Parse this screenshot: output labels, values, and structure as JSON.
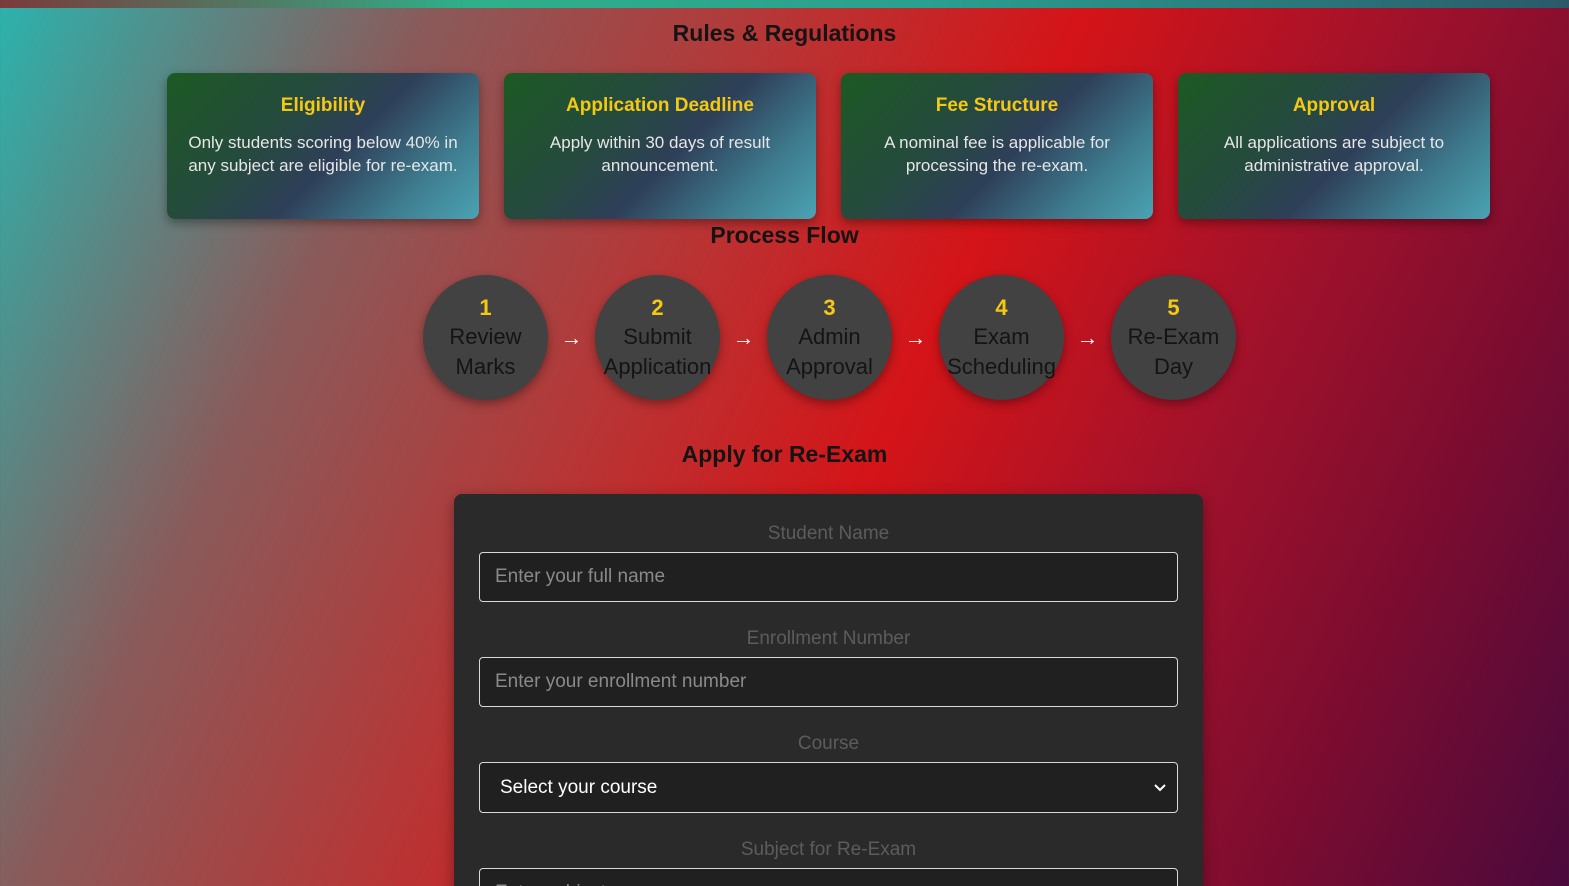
{
  "rules": {
    "title": "Rules & Regulations",
    "cards": [
      {
        "title": "Eligibility",
        "text": "Only students scoring below 40% in any subject are eligible for re-exam."
      },
      {
        "title": "Application Deadline",
        "text": "Apply within 30 days of result announcement."
      },
      {
        "title": "Fee Structure",
        "text": "A nominal fee is applicable for processing the re-exam."
      },
      {
        "title": "Approval",
        "text": "All applications are subject to administrative approval."
      }
    ]
  },
  "process": {
    "title": "Process Flow",
    "arrow": "→",
    "steps": [
      {
        "num": "1",
        "line1": "Review",
        "line2": "Marks"
      },
      {
        "num": "2",
        "line1": "Submit",
        "line2": "Application"
      },
      {
        "num": "3",
        "line1": "Admin",
        "line2": "Approval"
      },
      {
        "num": "4",
        "line1": "Exam",
        "line2": "Scheduling"
      },
      {
        "num": "5",
        "line1": "Re-Exam",
        "line2": "Day"
      }
    ]
  },
  "apply": {
    "title": "Apply for Re-Exam",
    "student_name": {
      "label": "Student Name",
      "placeholder": "Enter your full name"
    },
    "enrollment": {
      "label": "Enrollment Number",
      "placeholder": "Enter your enrollment number"
    },
    "course": {
      "label": "Course",
      "selected": "Select your course"
    },
    "subject": {
      "label": "Subject for Re-Exam",
      "placeholder": "Enter subject name"
    }
  }
}
